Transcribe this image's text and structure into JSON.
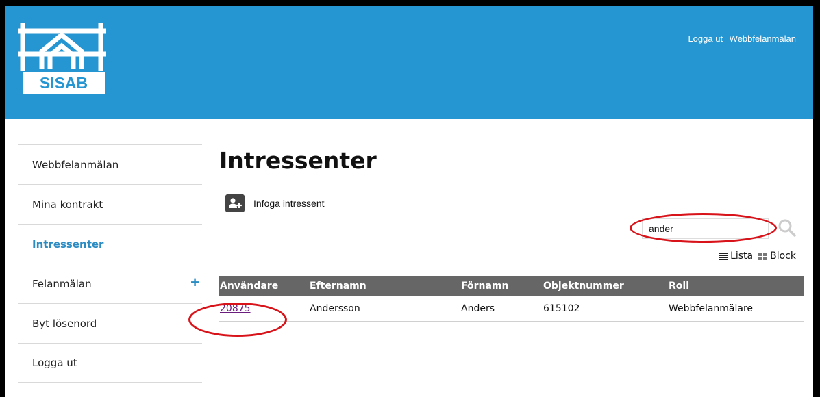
{
  "header": {
    "logo_text": "SISAB",
    "links": [
      "Logga ut",
      "Webbfelanmälan"
    ]
  },
  "sidebar": {
    "items": [
      {
        "label": "Webbfelanmälan"
      },
      {
        "label": "Mina kontrakt"
      },
      {
        "label": "Intressenter",
        "active": true
      },
      {
        "label": "Felanmälan",
        "has_plus": true
      },
      {
        "label": "Byt lösenord"
      },
      {
        "label": "Logga ut"
      }
    ],
    "plus_symbol": "+"
  },
  "main": {
    "title": "Intressenter",
    "add_button_label": "Infoga intressent",
    "search": {
      "value": "ander"
    },
    "view_options": [
      "Lista",
      "Block"
    ],
    "table": {
      "columns": [
        "Användare",
        "Efternamn",
        "Förnamn",
        "Objektnummer",
        "Roll"
      ],
      "rows": [
        [
          "20875",
          "Andersson",
          "Anders",
          "615102",
          "Webbfelanmälare"
        ]
      ]
    }
  },
  "colors": {
    "header_bg": "#2596d1",
    "active_nav": "#2b8cc4",
    "table_header_bg": "#666666",
    "link_visited": "#6b1e7e",
    "highlight_oval": "#d8131a"
  },
  "icons": [
    "sisab-house-logo",
    "add-user-icon",
    "search-icon",
    "list-view-icon",
    "block-view-icon",
    "plus-icon"
  ]
}
